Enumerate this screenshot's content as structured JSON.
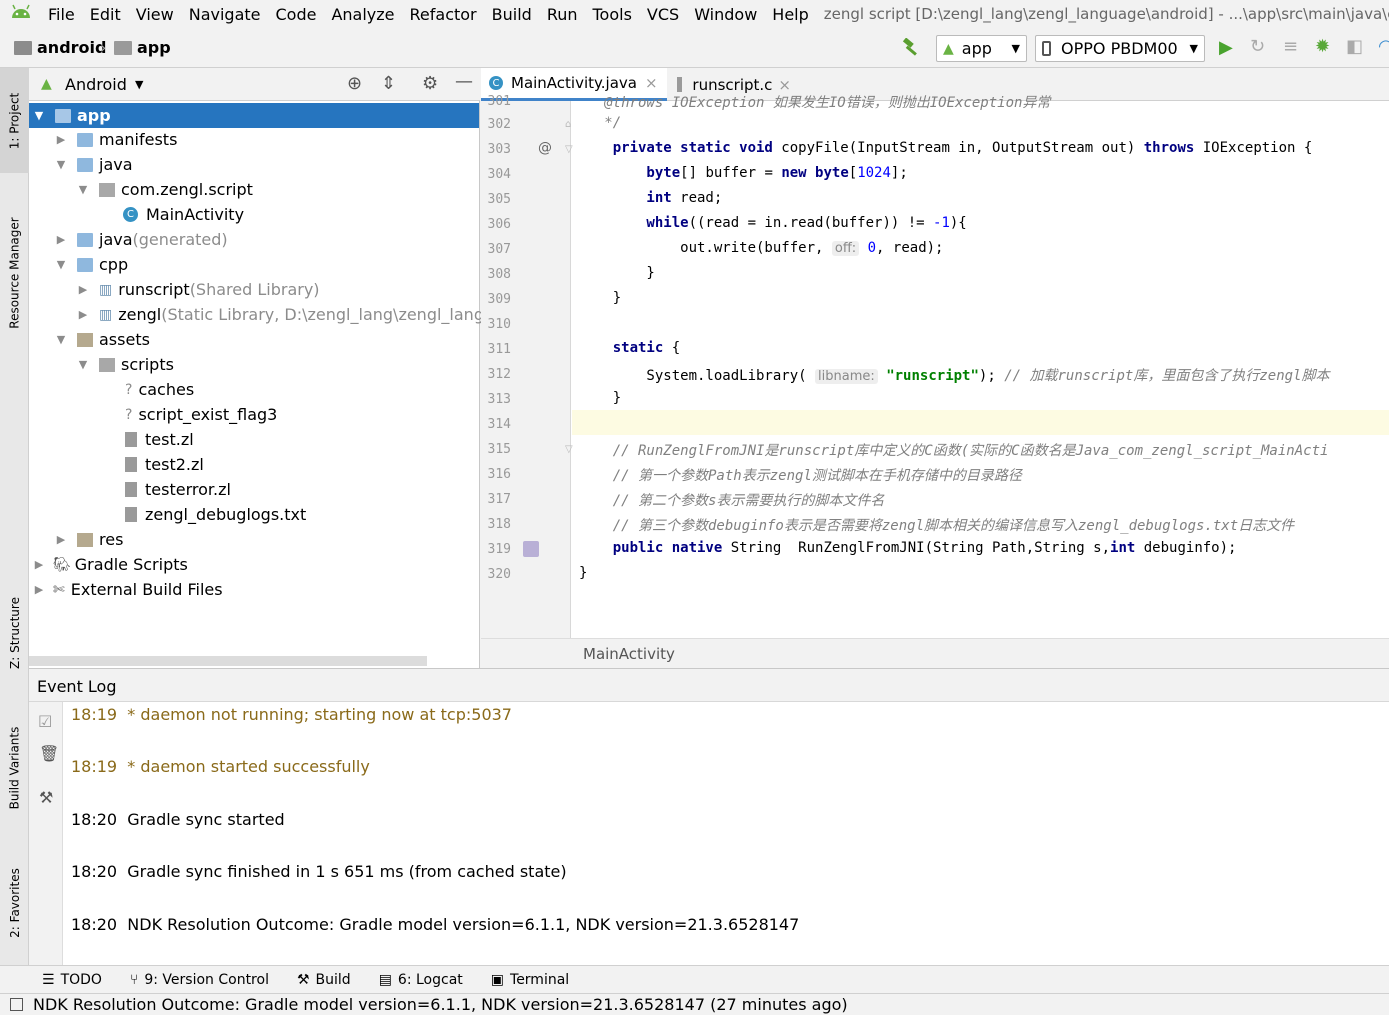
{
  "menubar": {
    "items": [
      "File",
      "Edit",
      "View",
      "Navigate",
      "Code",
      "Analyze",
      "Refactor",
      "Build",
      "Run",
      "Tools",
      "VCS",
      "Window",
      "Help"
    ],
    "title": "zengl script [D:\\zengl_lang\\zengl_language\\android] - ...\\app\\src\\main\\java\\com\\ze"
  },
  "navbar": {
    "crumb_root": "android",
    "crumb_module": "app",
    "run_config": "app",
    "device": "OPPO PBDM00"
  },
  "left_strip": {
    "project": "1: Project",
    "resource_manager": "Resource Manager",
    "structure": "Z: Structure",
    "build_variants": "Build Variants",
    "favorites": "2: Favorites"
  },
  "project_panel": {
    "view_mode": "Android",
    "tree": [
      {
        "label": "app",
        "extra": ""
      },
      {
        "label": "manifests",
        "extra": ""
      },
      {
        "label": "java",
        "extra": ""
      },
      {
        "label": "com.zengl.script",
        "extra": ""
      },
      {
        "label": "MainActivity",
        "extra": ""
      },
      {
        "label": "java",
        "extra": " (generated)"
      },
      {
        "label": "cpp",
        "extra": ""
      },
      {
        "label": "runscript",
        "extra": " (Shared Library)"
      },
      {
        "label": "zengl",
        "extra": " (Static Library, D:\\zengl_lang\\zengl_languag"
      },
      {
        "label": "assets",
        "extra": ""
      },
      {
        "label": "scripts",
        "extra": ""
      },
      {
        "label": "caches",
        "extra": ""
      },
      {
        "label": "script_exist_flag3",
        "extra": ""
      },
      {
        "label": "test.zl",
        "extra": ""
      },
      {
        "label": "test2.zl",
        "extra": ""
      },
      {
        "label": "testerror.zl",
        "extra": ""
      },
      {
        "label": "zengl_debuglogs.txt",
        "extra": ""
      },
      {
        "label": "res",
        "extra": ""
      },
      {
        "label": "Gradle Scripts",
        "extra": ""
      },
      {
        "label": "External Build Files",
        "extra": ""
      }
    ]
  },
  "editor": {
    "tabs": [
      {
        "label": "MainActivity.java",
        "close": "×"
      },
      {
        "label": "runscript.c",
        "close": "×"
      }
    ],
    "breadcrumb": "MainActivity",
    "line_numbers": [
      "301",
      "302",
      "303",
      "304",
      "305",
      "306",
      "307",
      "308",
      "309",
      "310",
      "311",
      "312",
      "313",
      "314",
      "315",
      "316",
      "317",
      "318",
      "319",
      "320"
    ],
    "lines": {
      "l301": "   @throws IOException 如果发生IO错误，则抛出IOException异常",
      "l302": "   */",
      "l303a": "    private static void",
      "l303b": " copyFile(InputStream in, OutputStream out) ",
      "l303c": "throws",
      "l303d": " IOException {",
      "l304a": "        byte",
      "l304b": "[] buffer = ",
      "l304c": "new byte",
      "l304d": "[",
      "l304e": "1024",
      "l304f": "];",
      "l305a": "        int",
      "l305b": " read;",
      "l306a": "        while",
      "l306b": "((read = in.read(buffer)) != ",
      "l306c": "-1",
      "l306d": "){",
      "l307a": "            out.write(buffer, ",
      "l307hint": "off:",
      "l307b": " ",
      "l307c": "0",
      "l307d": ", read);",
      "l308": "        }",
      "l309": "    }",
      "l311a": "    static",
      "l311b": " {",
      "l312a": "        System.loadLibrary( ",
      "l312hint": "libname:",
      "l312b": " ",
      "l312c": "\"runscript\"",
      "l312d": "); ",
      "l312e": "// 加载runscript库，里面包含了执行zengl脚本",
      "l313": "    }",
      "l315": "    // RunZenglFromJNI是runscript库中定义的C函数(实际的C函数名是Java_com_zengl_script_MainActi",
      "l316": "    // 第一个参数Path表示zengl测试脚本在手机存储中的目录路径",
      "l317": "    // 第二个参数s表示需要执行的脚本文件名",
      "l318": "    // 第三个参数debuginfo表示是否需要将zengl脚本相关的编译信息写入zengl_debuglogs.txt日志文件",
      "l319a": "    public native",
      "l319b": " String  RunZenglFromJNI(String Path,String s,",
      "l319c": "int",
      "l319d": " debuginfo);",
      "l320": "}"
    }
  },
  "event_log": {
    "title": "Event Log",
    "entries": [
      {
        "time": "18:19",
        "msg": "* daemon not running; starting now at tcp:5037"
      },
      {
        "time": "18:19",
        "msg": "* daemon started successfully"
      },
      {
        "time": "18:20",
        "msg": "Gradle sync started"
      },
      {
        "time": "18:20",
        "msg": "Gradle sync finished in 1 s 651 ms (from cached state)"
      },
      {
        "time": "18:20",
        "msg": "NDK Resolution Outcome: Gradle model version=6.1.1, NDK version=21.3.6528147"
      }
    ]
  },
  "bottom_tools": {
    "todo": "TODO",
    "version_control": "9: Version Control",
    "build": "Build",
    "logcat": "6: Logcat",
    "terminal": "Terminal"
  },
  "status": {
    "text": "NDK Resolution Outcome: Gradle model version=6.1.1, NDK version=21.3.6528147 (27 minutes ago)"
  },
  "colors": {
    "selection": "#2675bf",
    "keyword": "#000080",
    "string": "#008000",
    "comment": "#808080",
    "android_green": "#6ab344",
    "log_warning": "#8a6a1a"
  }
}
